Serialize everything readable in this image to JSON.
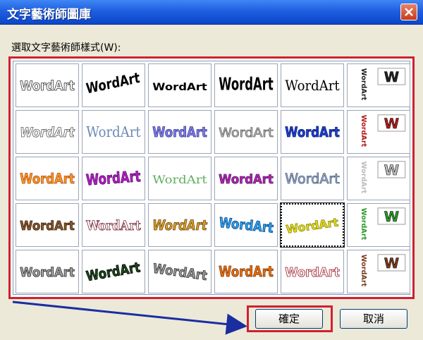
{
  "dialog": {
    "title": "文字藝術師圖庫",
    "prompt": "選取文字藝術師樣式(W):",
    "close_icon": "close-icon",
    "ok_label": "確定",
    "cancel_label": "取消"
  },
  "gallery": {
    "sample_text": "WordArt",
    "vertical_text": "WordArt",
    "small_sample": "W",
    "selected_index": 22,
    "accent": "#d02030"
  }
}
